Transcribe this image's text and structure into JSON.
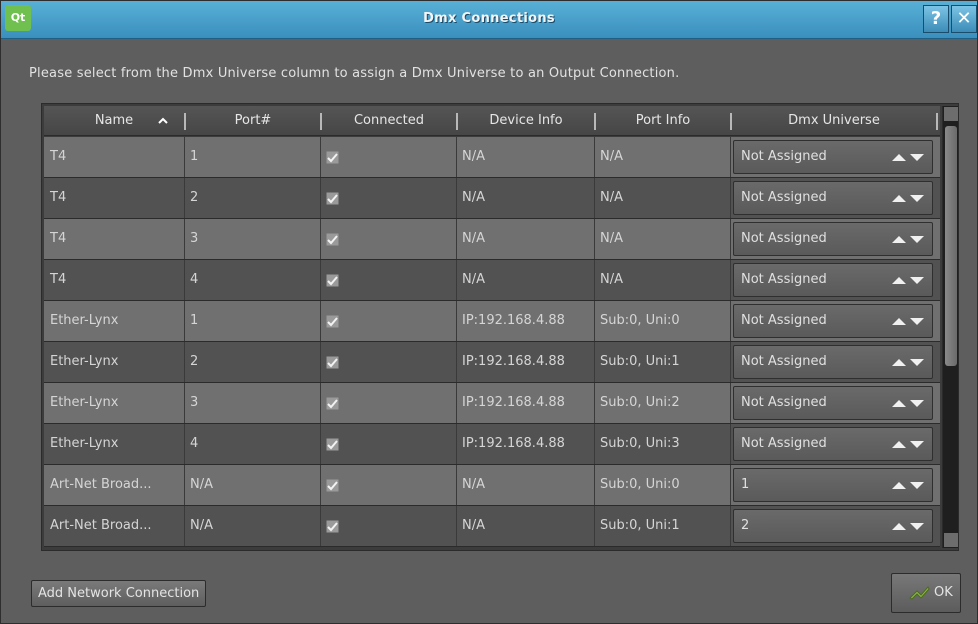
{
  "window": {
    "title": "Dmx Connections",
    "logo_text": "Qt",
    "help_label": "?",
    "close_label": "✕"
  },
  "instruction": "Please select from the Dmx Universe column to assign a Dmx Universe to an Output Connection.",
  "table": {
    "columns": [
      "Name",
      "Port#",
      "Connected",
      "Device Info",
      "Port Info",
      "Dmx Universe"
    ],
    "sort_column": "Name",
    "sort_direction": "ascending",
    "rows": [
      {
        "name": "T4",
        "port": "1",
        "connected": true,
        "device_info": "N/A",
        "port_info": "N/A",
        "universe": "Not Assigned"
      },
      {
        "name": "T4",
        "port": "2",
        "connected": true,
        "device_info": "N/A",
        "port_info": "N/A",
        "universe": "Not Assigned"
      },
      {
        "name": "T4",
        "port": "3",
        "connected": true,
        "device_info": "N/A",
        "port_info": "N/A",
        "universe": "Not Assigned"
      },
      {
        "name": "T4",
        "port": "4",
        "connected": true,
        "device_info": "N/A",
        "port_info": "N/A",
        "universe": "Not Assigned"
      },
      {
        "name": "Ether-Lynx",
        "port": "1",
        "connected": true,
        "device_info": "IP:192.168.4.88",
        "port_info": "Sub:0, Uni:0",
        "universe": "Not Assigned"
      },
      {
        "name": "Ether-Lynx",
        "port": "2",
        "connected": true,
        "device_info": "IP:192.168.4.88",
        "port_info": "Sub:0, Uni:1",
        "universe": "Not Assigned"
      },
      {
        "name": "Ether-Lynx",
        "port": "3",
        "connected": true,
        "device_info": "IP:192.168.4.88",
        "port_info": "Sub:0, Uni:2",
        "universe": "Not Assigned"
      },
      {
        "name": "Ether-Lynx",
        "port": "4",
        "connected": true,
        "device_info": "IP:192.168.4.88",
        "port_info": "Sub:0, Uni:3",
        "universe": "Not Assigned"
      },
      {
        "name": "Art-Net Broad...",
        "port": "N/A",
        "connected": true,
        "device_info": "N/A",
        "port_info": "Sub:0, Uni:0",
        "universe": "1"
      },
      {
        "name": "Art-Net Broad...",
        "port": "N/A",
        "connected": true,
        "device_info": "N/A",
        "port_info": "Sub:0, Uni:1",
        "universe": "2"
      }
    ]
  },
  "buttons": {
    "add_network": "Add Network Connection",
    "ok": "OK"
  },
  "colors": {
    "title_bar": "#3a8fbd",
    "row_light": "#707070",
    "row_dark": "#525252",
    "background": "#5e5e5e"
  }
}
